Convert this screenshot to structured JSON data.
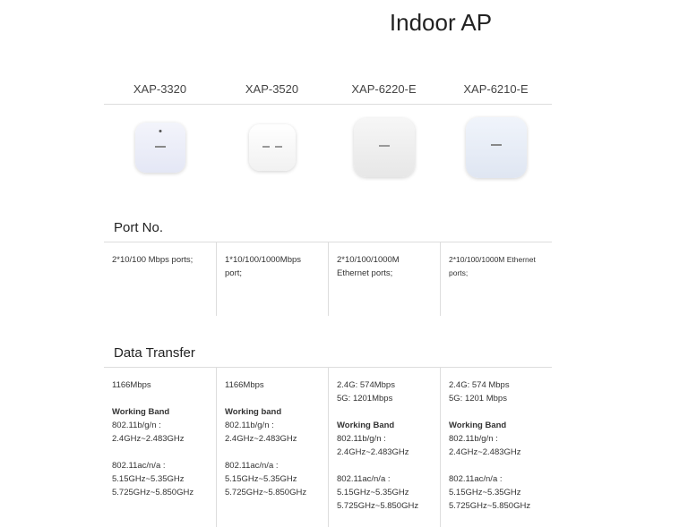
{
  "page": {
    "title": "Indoor AP"
  },
  "models": [
    "XAP-3320",
    "XAP-3520",
    "XAP-6220-E",
    "XAP-6210-E"
  ],
  "sections": {
    "port": {
      "title": "Port No.",
      "cells": [
        [
          "2*10/100 Mbps ports;"
        ],
        [
          "1*10/100/1000Mbps",
          "port;"
        ],
        [
          "2*10/100/1000M",
          "Ethernet ports;"
        ],
        [
          "2*10/100/1000M Ethernet",
          "ports;"
        ]
      ]
    },
    "data_transfer": {
      "title": "Data Transfer",
      "cells": [
        {
          "rate": [
            "1166Mbps"
          ],
          "band_label": "Working Band",
          "band_1": [
            "802.11b/g/n :",
            "2.4GHz~2.483GHz"
          ],
          "band_2": [
            "802.11ac/n/a :",
            "5.15GHz~5.35GHz",
            "5.725GHz~5.850GHz"
          ]
        },
        {
          "rate": [
            "1166Mbps"
          ],
          "band_label": "Working band",
          "band_1": [
            "802.11b/g/n :",
            "2.4GHz~2.483GHz"
          ],
          "band_2": [
            "802.11ac/n/a :",
            "5.15GHz~5.35GHz",
            "5.725GHz~5.850GHz"
          ]
        },
        {
          "rate": [
            "2.4G:  574Mbps",
            "5G:  1201Mbps"
          ],
          "band_label": "Working Band",
          "band_1": [
            "802.11b/g/n :",
            "2.4GHz~2.483GHz"
          ],
          "band_2": [
            "802.11ac/n/a :",
            "5.15GHz~5.35GHz",
            "5.725GHz~5.850GHz"
          ]
        },
        {
          "rate": [
            "2.4G:  574 Mbps",
            "5G:  1201 Mbps"
          ],
          "band_label": "Working Band",
          "band_1": [
            "802.11b/g/n :",
            "2.4GHz~2.483GHz"
          ],
          "band_2": [
            "802.11ac/n/a :",
            "5.15GHz~5.35GHz",
            "5.725GHz~5.850GHz"
          ]
        }
      ]
    }
  },
  "colors": {
    "divider": "#dddddd",
    "text": "#333333",
    "title": "#222222"
  }
}
